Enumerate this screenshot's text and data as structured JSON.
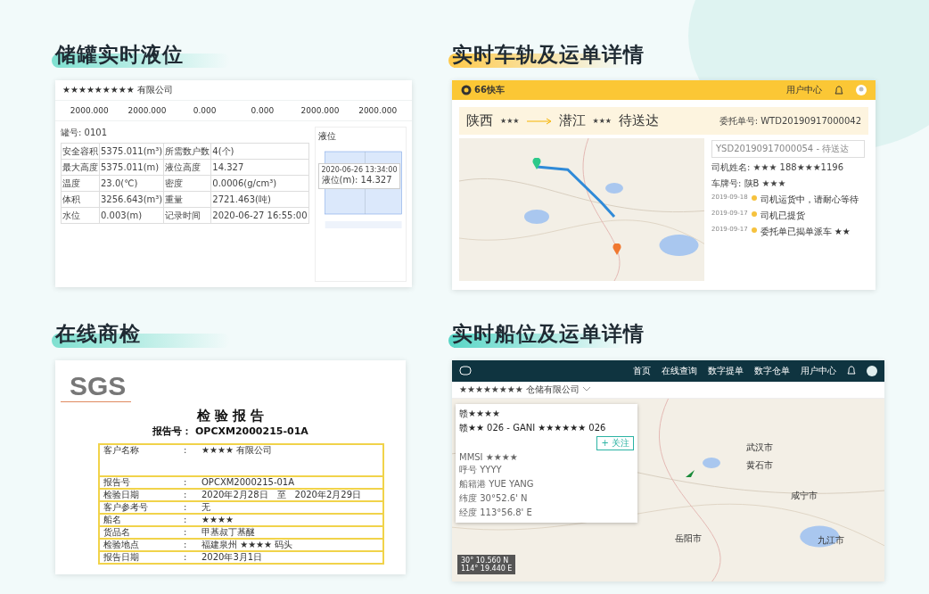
{
  "sections": [
    {
      "kind": "tank",
      "heading": "储罐实时液位",
      "company": "★★★★★★★★★ 有限公司",
      "stats": [
        "2000.000",
        "2000.000",
        "0.000",
        "0.000",
        "2000.000",
        "2000.000"
      ],
      "tank_no": "罐号: 0101",
      "table": [
        [
          "安全容积",
          "5375.011(m³)",
          "所需数户数",
          "4(个)"
        ],
        [
          "最大高度",
          "5375.011(m)",
          "液位高度",
          "14.327"
        ],
        [
          "温度",
          "23.0(℃)",
          "密度",
          "0.0006(g/cm³)"
        ],
        [
          "体积",
          "3256.643(m³)",
          "重量",
          "2721.463(吨)"
        ],
        [
          "水位",
          "0.003(m)",
          "记录时间",
          "2020-06-27 16:55:00"
        ]
      ],
      "chart_title": "液位",
      "tooltip": [
        "2020-06-26 13:34:00",
        "液位(m): 14.327"
      ]
    },
    {
      "kind": "truck",
      "heading": "实时车轨及运单详情",
      "logo": "66快车",
      "nav": [
        "用户中心"
      ],
      "from": "陕西",
      "from_mask": "★★★",
      "to": "潜江",
      "to_mask": "★★★",
      "status": "待送达",
      "order_no": "委托单号: WTD20190917000042",
      "waybill": "YSD20190917000054 - 待送达",
      "driver": "司机姓名: ★★★ 188★★★1196",
      "plate": "车牌号: 陕B ★★★",
      "events": [
        {
          "date": "2019-09-18",
          "text": "司机运货中，请耐心等待"
        },
        {
          "date": "2019-09-17",
          "text": "司机已提货"
        },
        {
          "date": "2019-09-17",
          "text": "委托单已揭单派车 ★★"
        }
      ]
    },
    {
      "kind": "report",
      "heading": "在线商检",
      "logo": "SGS",
      "sep": ":",
      "title": "检 验 报 告",
      "report_no": "报告号： OPCXM2000215-01A",
      "rows": [
        [
          "客户名称",
          "★★★★ 有限公司"
        ],
        [
          "报告号",
          "OPCXM2000215-01A"
        ],
        [
          "检验日期",
          "2020年2月28日　至　2020年2月29日"
        ],
        [
          "客户参考号",
          "无"
        ],
        [
          "船名",
          "★★★★"
        ],
        [
          "货品名",
          "甲基叔丁基醚"
        ],
        [
          "检验地点",
          "福建泉州 ★★★★ 码头"
        ],
        [
          "报告日期",
          "2020年3月1日"
        ]
      ]
    },
    {
      "kind": "ship",
      "heading": "实时船位及运单详情",
      "nav": [
        "首页",
        "在线查询",
        "数字提单",
        "数字仓单",
        "用户中心"
      ],
      "company": "★★★★★★★★ 仓储有限公司",
      "search": "赣★★★★",
      "vessel": "赣★★ 026 - GANI ★★★★★★ 026",
      "follow": "+ 关注",
      "fields": [
        "MMSI ★★★★",
        "呼号 YYYY",
        "船籍港 YUE YANG",
        "纬度 30°52.6' N",
        "经度 113°56.8' E"
      ],
      "places": [
        "武汉市",
        "黄石市",
        "咸宁市",
        "岳阳市",
        "九江市"
      ],
      "coords": [
        "30° 10.560 N",
        "114° 19.440 E"
      ]
    }
  ]
}
